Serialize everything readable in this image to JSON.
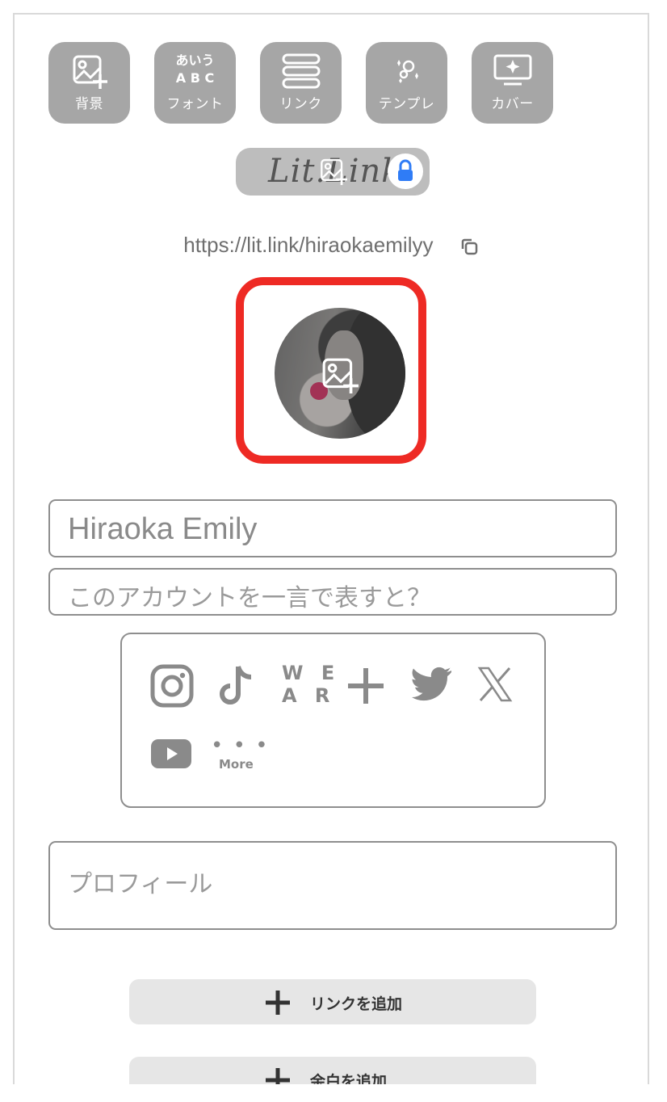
{
  "toolbar": {
    "items": [
      {
        "label": "背景",
        "icon": "image-add-icon"
      },
      {
        "label": "フォント",
        "icon": "font-icon",
        "sample_line1": "あいう",
        "sample_line2": "A B C"
      },
      {
        "label": "リンク",
        "icon": "link-stack-icon"
      },
      {
        "label": "テンプレ",
        "icon": "sparkle-template-icon"
      },
      {
        "label": "カバー",
        "icon": "cover-monitor-icon"
      }
    ]
  },
  "logo": {
    "text": "Lit.Link"
  },
  "profile_url": "https://lit.link/hiraokaemilyy",
  "name_input": {
    "value": "Hiraoka Emily"
  },
  "tagline_input": {
    "placeholder": "このアカウントを一言で表すと？"
  },
  "sns": {
    "wear_line1": "W E",
    "wear_line2": "A R",
    "more_dots": "• • •",
    "more_label": "More"
  },
  "profile_input": {
    "placeholder": "プロフィール"
  },
  "buttons": {
    "add_link": "リンクを追加",
    "add_space": "余白を追加"
  },
  "colors": {
    "highlight_border": "#ee2a24",
    "lock_icon": "#2f7cf6",
    "toolbar_bg": "#a6a6a6"
  }
}
